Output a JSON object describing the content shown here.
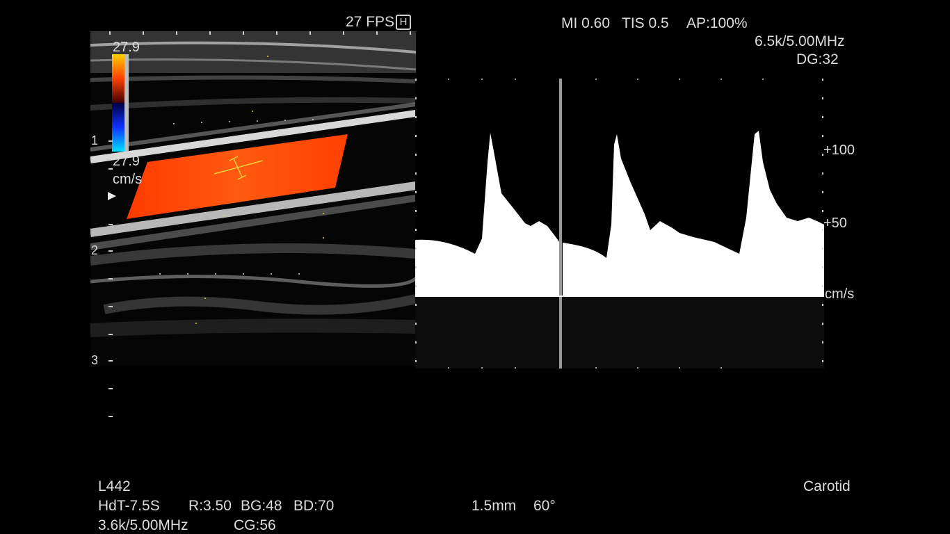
{
  "header": {
    "fps": "27 FPS",
    "h_badge": "H",
    "mi": "MI 0.60",
    "tis": "TIS 0.5",
    "ap": "AP:100%",
    "pw_freq": "6.5k/5.00MHz",
    "dg": "DG:32"
  },
  "color_scale": {
    "top_value": "27.9",
    "bottom_value": "27.9",
    "unit": "cm/s",
    "colors": {
      "red": "#ff3a00",
      "orange": "#ffb000",
      "blue": "#2040ff",
      "cyan": "#00d8ff"
    }
  },
  "depth_markers": [
    "1",
    "2",
    "3"
  ],
  "velocity_scale": {
    "labels": [
      "+100",
      "+50"
    ],
    "unit": "cm/s"
  },
  "footer": {
    "probe": "L442",
    "preset": "HdT-7.5S",
    "r": "R:3.50",
    "bg": "BG:48",
    "bd": "BD:70",
    "cf_freq": "3.6k/5.00MHz",
    "cg": "CG:56",
    "gate": "1.5mm",
    "angle": "60°",
    "exam": "Carotid"
  },
  "colors": {
    "flow_box": "#ff4a08",
    "spectrum": "#ffffff",
    "annotation": "#f0d040"
  }
}
